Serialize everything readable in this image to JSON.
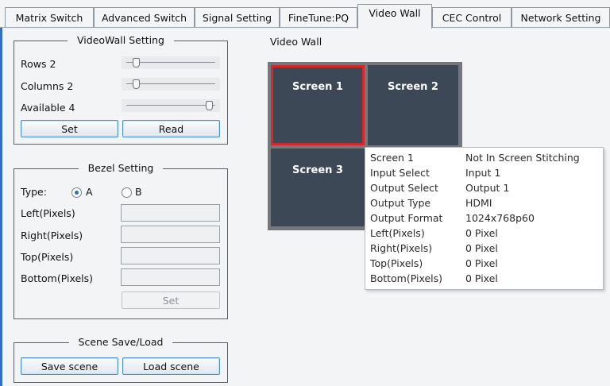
{
  "tabs": [
    {
      "label": "Matrix Switch"
    },
    {
      "label": "Advanced Switch"
    },
    {
      "label": "Signal Setting"
    },
    {
      "label": "FineTune:PQ"
    },
    {
      "label": "Video Wall",
      "active": true
    },
    {
      "label": "CEC Control"
    },
    {
      "label": "Network Setting"
    }
  ],
  "videowall_setting": {
    "title": "VideoWall Setting",
    "rows_label": "Rows 2",
    "columns_label": "Columns 2",
    "available_label": "Available 4",
    "rows_value": 2,
    "columns_value": 2,
    "available_value": 4,
    "set_label": "Set",
    "read_label": "Read"
  },
  "bezel_setting": {
    "title": "Bezel Setting",
    "type_label": "Type:",
    "option_a": "A",
    "option_b": "B",
    "selected": "A",
    "left_label": "Left(Pixels)",
    "right_label": "Right(Pixels)",
    "top_label": "Top(Pixels)",
    "bottom_label": "Bottom(Pixels)",
    "left_value": "",
    "right_value": "",
    "top_value": "",
    "bottom_value": "",
    "set_label": "Set"
  },
  "scene": {
    "title": "Scene Save/Load",
    "save_label": "Save scene",
    "load_label": "Load scene"
  },
  "video_wall": {
    "title": "Video Wall",
    "screens": [
      "Screen 1",
      "Screen 2",
      "Screen 3"
    ]
  },
  "tooltip": {
    "rows": [
      {
        "key": "Screen 1",
        "value": "Not In Screen Stitching"
      },
      {
        "key": "Input Select",
        "value": "Input 1"
      },
      {
        "key": "Output Select",
        "value": "Output 1"
      },
      {
        "key": "Output Type",
        "value": "HDMI"
      },
      {
        "key": "Output Format",
        "value": "1024x768p60"
      },
      {
        "key": "Left(Pixels)",
        "value": "0 Pixel"
      },
      {
        "key": "Right(Pixels)",
        "value": "0 Pixel"
      },
      {
        "key": "Top(Pixels)",
        "value": "0 Pixel"
      },
      {
        "key": "Bottom(Pixels)",
        "value": "0 Pixel"
      }
    ]
  },
  "colors": {
    "accent": "#4a90c8",
    "screen_bg": "#3d4856",
    "selected_border": "#d8262b",
    "wall_frame": "#74787d"
  }
}
